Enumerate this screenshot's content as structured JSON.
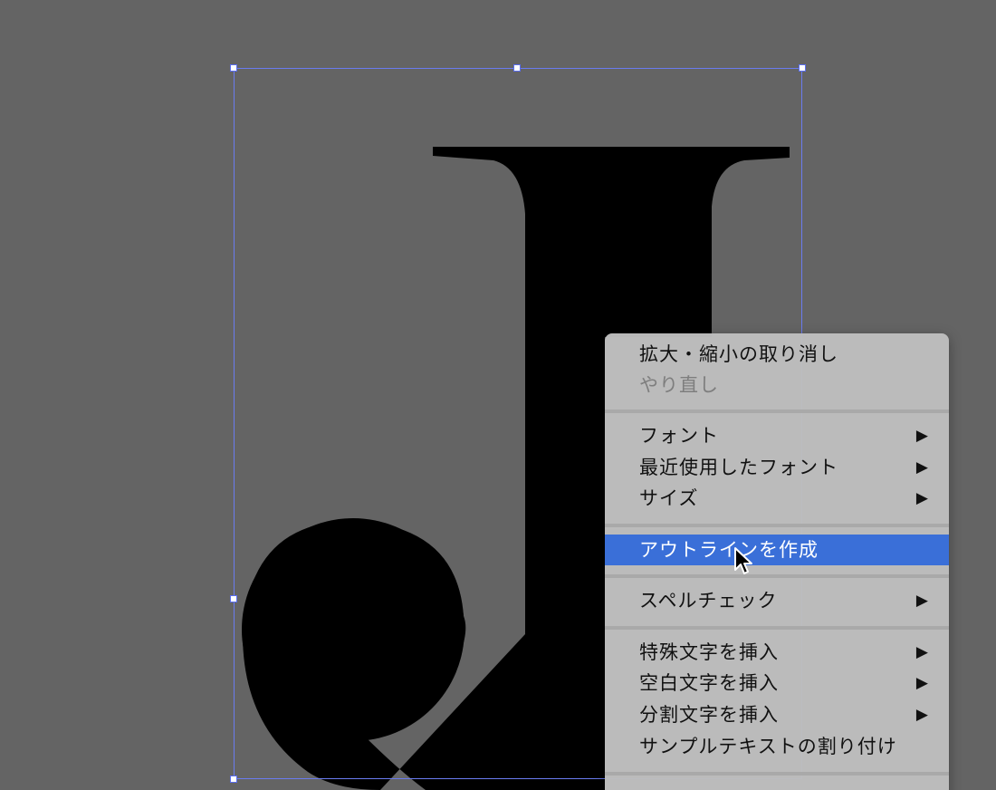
{
  "canvas": {
    "background": "#646464",
    "glyph": "J",
    "selection_color": "#6a7cf0"
  },
  "context_menu": {
    "items": [
      {
        "label": "拡大・縮小の取り消し",
        "enabled": true
      },
      {
        "label": "やり直し",
        "enabled": false
      },
      {
        "label": "フォント",
        "submenu": true
      },
      {
        "label": "最近使用したフォント",
        "submenu": true
      },
      {
        "label": "サイズ",
        "submenu": true
      },
      {
        "label": "アウトラインを作成",
        "highlighted": true
      },
      {
        "label": "スペルチェック",
        "submenu": true
      },
      {
        "label": "特殊文字を挿入",
        "submenu": true
      },
      {
        "label": "空白文字を挿入",
        "submenu": true
      },
      {
        "label": "分割文字を挿入",
        "submenu": true
      },
      {
        "label": "サンプルテキストの割り付け"
      }
    ],
    "submenu_arrow": "▶",
    "highlight_color": "#3a6fd8"
  }
}
